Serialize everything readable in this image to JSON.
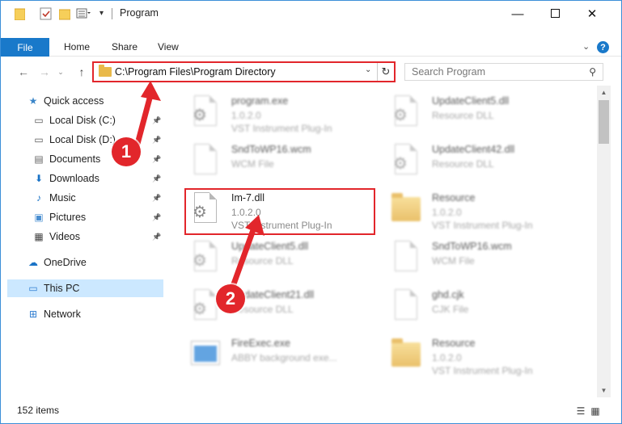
{
  "window": {
    "title": "Program",
    "minimize_icon": "minimize-icon",
    "maximize_icon": "maximize-icon",
    "close_icon": "close-icon"
  },
  "ribbon": {
    "tabs": [
      "File",
      "Home",
      "Share",
      "View"
    ],
    "help": "?"
  },
  "address_bar": {
    "path": "C:\\Program Files\\Program Directory"
  },
  "search": {
    "placeholder": "Search Program"
  },
  "sidebar": {
    "items": [
      {
        "label": "Quick access",
        "icon": "star-icon"
      },
      {
        "label": "Local Disk (C:)",
        "icon": "drive-icon",
        "pinned": true
      },
      {
        "label": "Local Disk (D:)",
        "icon": "drive-icon",
        "pinned": true
      },
      {
        "label": "Documents",
        "icon": "documents-icon",
        "pinned": true
      },
      {
        "label": "Downloads",
        "icon": "download-icon",
        "pinned": true
      },
      {
        "label": "Music",
        "icon": "music-icon",
        "pinned": true
      },
      {
        "label": "Pictures",
        "icon": "pictures-icon",
        "pinned": true
      },
      {
        "label": "Videos",
        "icon": "videos-icon",
        "pinned": true
      },
      {
        "label": "OneDrive",
        "icon": "cloud-icon"
      },
      {
        "label": "This PC",
        "icon": "computer-icon",
        "selected": true
      },
      {
        "label": "Network",
        "icon": "network-icon"
      }
    ]
  },
  "files": [
    {
      "name": "program.exe",
      "line2": "1.0.2.0",
      "line3": "VST Instrument Plug-In",
      "icon": "program-exe-icon"
    },
    {
      "name": "UpdateClient5.dll",
      "line2": "Resource DLL",
      "line3": "",
      "icon": "dll-icon"
    },
    {
      "name": "SndToWP16.wcm",
      "line2": "WCM File",
      "line3": "",
      "icon": "file-icon"
    },
    {
      "name": "UpdateClient42.dll",
      "line2": "Resource DLL",
      "line3": "",
      "icon": "dll-icon"
    },
    {
      "name": "Im-7.dll",
      "line2": "1.0.2.0",
      "line3": "VST Instrument Plug-In",
      "icon": "dll-icon"
    },
    {
      "name": "Resource",
      "line2": "1.0.2.0",
      "line3": "VST Instrument Plug-In",
      "icon": "folder-icon"
    },
    {
      "name": "UpdateClient5.dll",
      "line2": "Resource DLL",
      "line3": "",
      "icon": "dll-icon"
    },
    {
      "name": "SndToWP16.wcm",
      "line2": "WCM File",
      "line3": "",
      "icon": "file-icon"
    },
    {
      "name": "UpdateClient21.dll",
      "line2": "Resource DLL",
      "line3": "",
      "icon": "dll-icon"
    },
    {
      "name": "ghd.cjk",
      "line2": "CJK File",
      "line3": "",
      "icon": "file-icon"
    },
    {
      "name": "FireExec.exe",
      "line2": "ABBY background exe...",
      "line3": "",
      "icon": "exe-icon"
    },
    {
      "name": "Resource",
      "line2": "1.0.2.0",
      "line3": "VST Instrument Plug-In",
      "icon": "folder-icon"
    }
  ],
  "annotations": {
    "step1": "1",
    "step2": "2",
    "color": "#e2262b"
  },
  "status_bar": {
    "item_count": "152 items"
  }
}
